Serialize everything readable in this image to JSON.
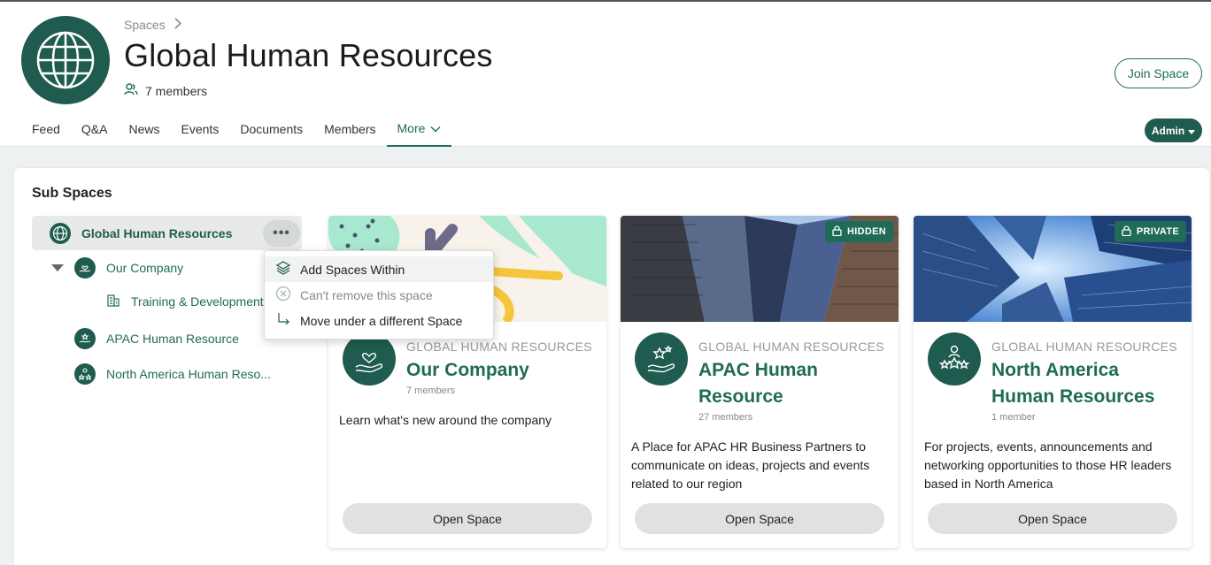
{
  "breadcrumb": {
    "label": "Spaces"
  },
  "space": {
    "title": "Global Human Resources",
    "members": "7 members"
  },
  "header": {
    "join_label": "Join Space",
    "admin_label": "Admin"
  },
  "tabs": [
    {
      "label": "Feed"
    },
    {
      "label": "Q&A"
    },
    {
      "label": "News"
    },
    {
      "label": "Events"
    },
    {
      "label": "Documents"
    },
    {
      "label": "Members"
    },
    {
      "label": "More"
    }
  ],
  "subspaces": {
    "title": "Sub Spaces",
    "tree": {
      "root": "Global Human Resources",
      "our_company": "Our Company",
      "training": "Training & Development",
      "apac": "APAC Human Resource",
      "north_america": "North America Human Reso..."
    },
    "menu": {
      "add": "Add Spaces Within",
      "cant_remove": "Can't remove this space",
      "move": "Move under a different Space"
    },
    "cards": [
      {
        "parent": "GLOBAL HUMAN RESOURCES",
        "name": "Our Company",
        "count": "7 members",
        "desc": "Learn what's new around the company",
        "button": "Open Space"
      },
      {
        "parent": "GLOBAL HUMAN RESOURCES",
        "name": "APAC Human Resource",
        "count": "27 members",
        "desc": "A Place for APAC HR Business Partners to communicate on ideas, projects and events related to our region",
        "button": "Open Space",
        "badge": "HIDDEN"
      },
      {
        "parent": "GLOBAL HUMAN RESOURCES",
        "name": "North America Human Resources",
        "count": "1 member",
        "desc": "For projects, events, announcements and networking opportunities to those HR leaders based in North America",
        "button": "Open Space",
        "badge": "PRIVATE"
      }
    ]
  },
  "colors": {
    "brand": "#1f5c4f",
    "accent": "#1f6b58"
  }
}
